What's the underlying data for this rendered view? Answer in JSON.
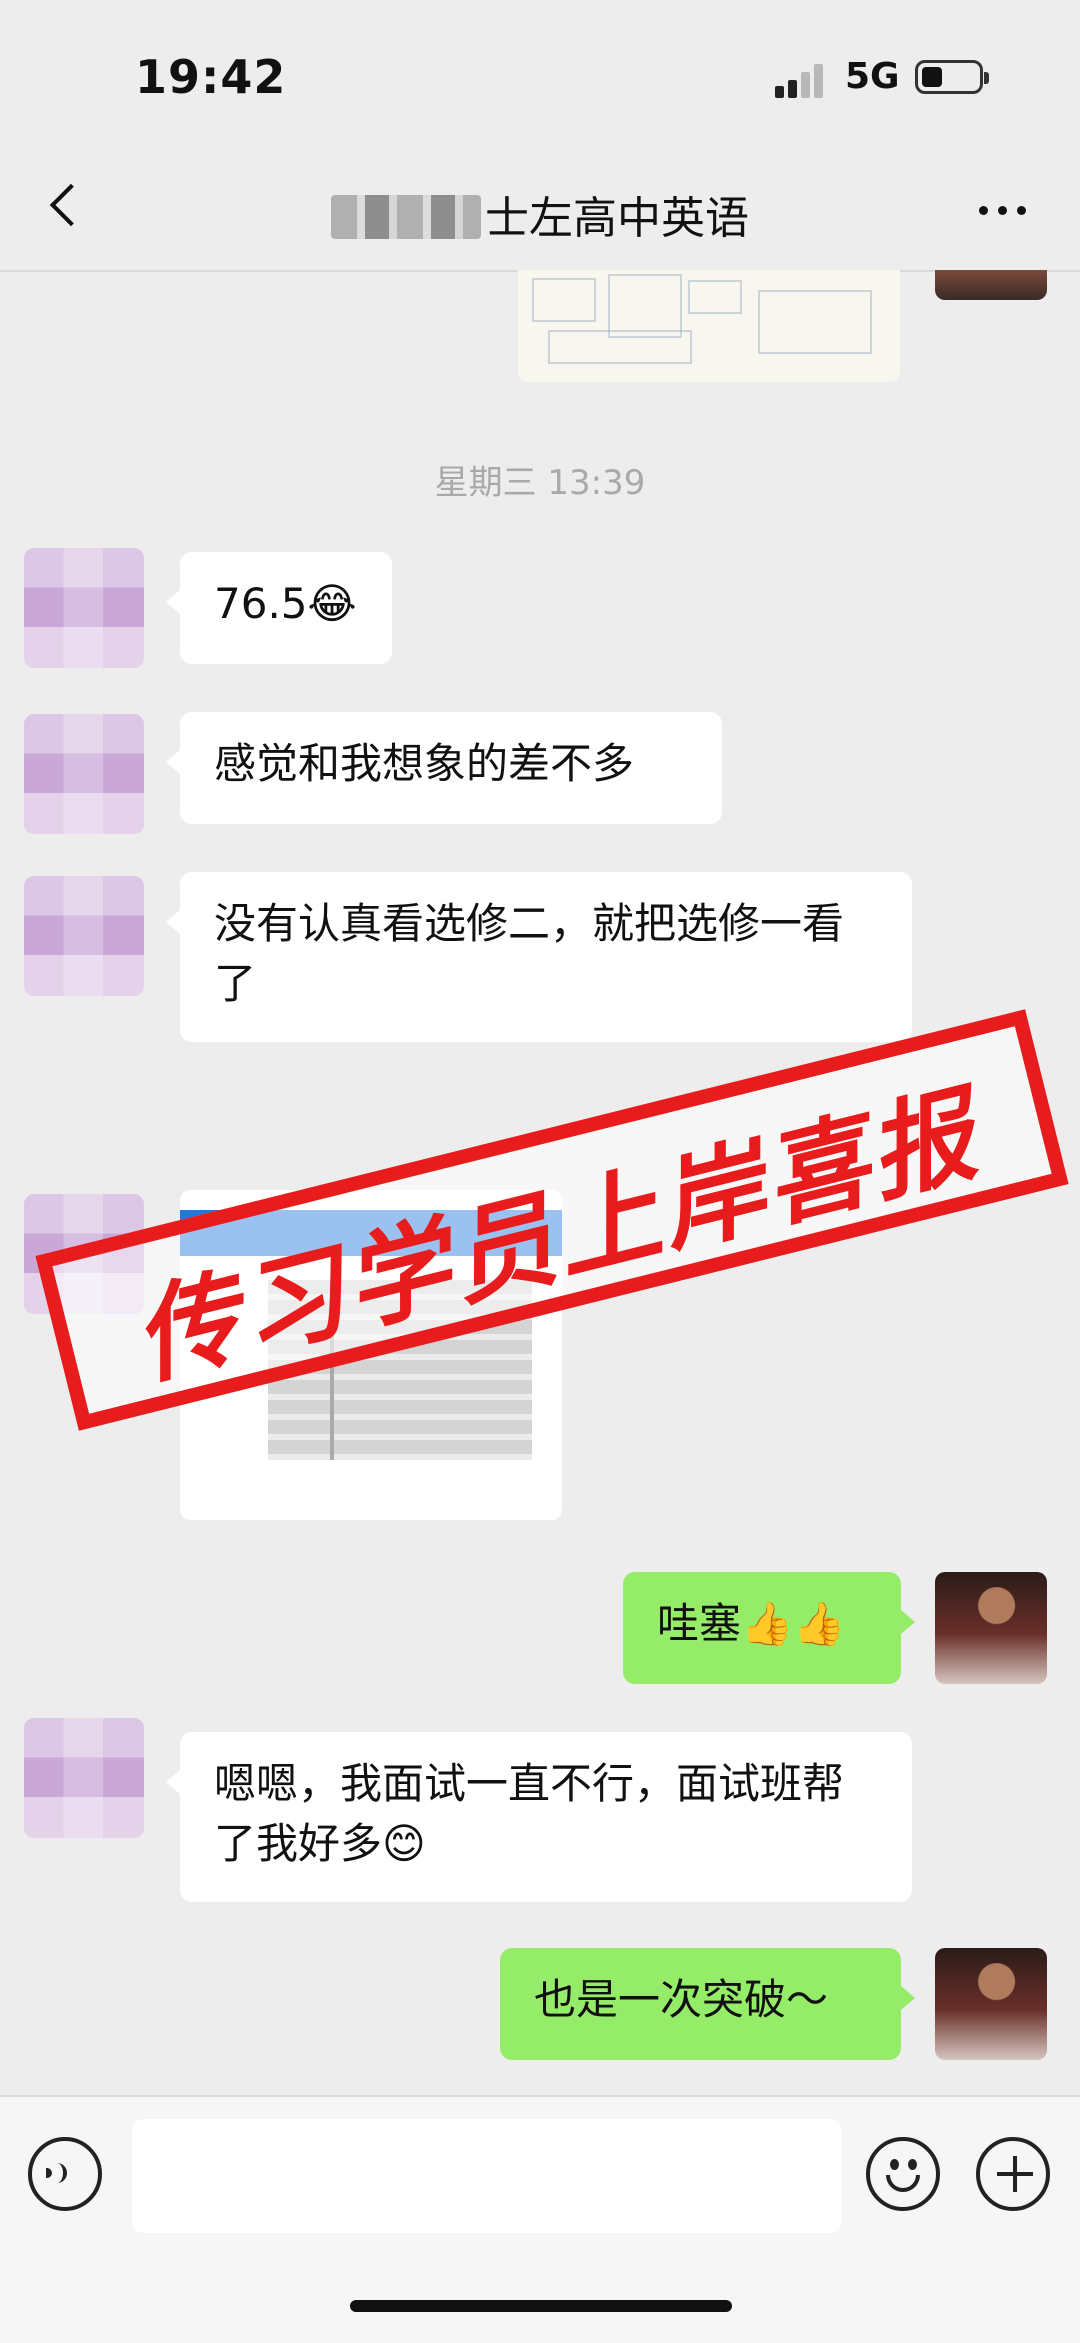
{
  "status": {
    "time": "19:42",
    "network": "5G",
    "signal_icon": "cellular-signal-icon",
    "battery_icon": "battery-icon"
  },
  "nav": {
    "title": "士左高中英语",
    "back_icon": "back-chevron-icon",
    "more_icon": "more-dots-icon"
  },
  "messages": {
    "timestamp1": "星期三 13:39",
    "m1": "76.5😂",
    "m2": "感觉和我想象的差不多",
    "m3": "没有认真看选修二，就把选修一看了",
    "m4": "哇塞👍👍",
    "m5": "嗯嗯，我面试一直不行，面试班帮了我好多😊",
    "m6": "也是一次突破～"
  },
  "stamp": {
    "text": "传习学员上岸喜报",
    "color": "#e81c1c"
  },
  "input": {
    "placeholder": ""
  },
  "colors": {
    "background": "#ededed",
    "outgoing_bubble": "#95ec69",
    "incoming_bubble": "#ffffff"
  }
}
